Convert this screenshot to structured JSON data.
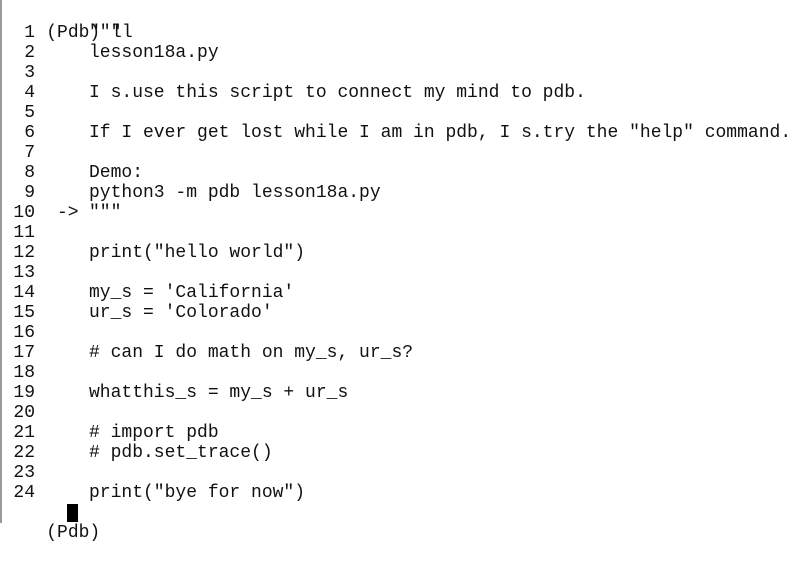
{
  "terminal": {
    "command_line": "(Pdb) ll",
    "prompt": "(Pdb) ",
    "current_line_marker": "->",
    "lines": [
      {
        "no": "1",
        "text": "\"\"\""
      },
      {
        "no": "2",
        "text": "lesson18a.py"
      },
      {
        "no": "3",
        "text": ""
      },
      {
        "no": "4",
        "text": "I s.use this script to connect my mind to pdb."
      },
      {
        "no": "5",
        "text": ""
      },
      {
        "no": "6",
        "text": "If I ever get lost while I am in pdb, I s.try the \"help\" command."
      },
      {
        "no": "7",
        "text": ""
      },
      {
        "no": "8",
        "text": "Demo:"
      },
      {
        "no": "9",
        "text": "python3 -m pdb lesson18a.py"
      },
      {
        "no": "10",
        "text": "\"\"\"",
        "current": true
      },
      {
        "no": "11",
        "text": ""
      },
      {
        "no": "12",
        "text": "print(\"hello world\")"
      },
      {
        "no": "13",
        "text": ""
      },
      {
        "no": "14",
        "text": "my_s = 'California'"
      },
      {
        "no": "15",
        "text": "ur_s = 'Colorado'"
      },
      {
        "no": "16",
        "text": ""
      },
      {
        "no": "17",
        "text": "# can I do math on my_s, ur_s?"
      },
      {
        "no": "18",
        "text": ""
      },
      {
        "no": "19",
        "text": "whatthis_s = my_s + ur_s"
      },
      {
        "no": "20",
        "text": ""
      },
      {
        "no": "21",
        "text": "# import pdb"
      },
      {
        "no": "22",
        "text": "# pdb.set_trace()"
      },
      {
        "no": "23",
        "text": ""
      },
      {
        "no": "24",
        "text": "print(\"bye for now\")"
      }
    ]
  }
}
